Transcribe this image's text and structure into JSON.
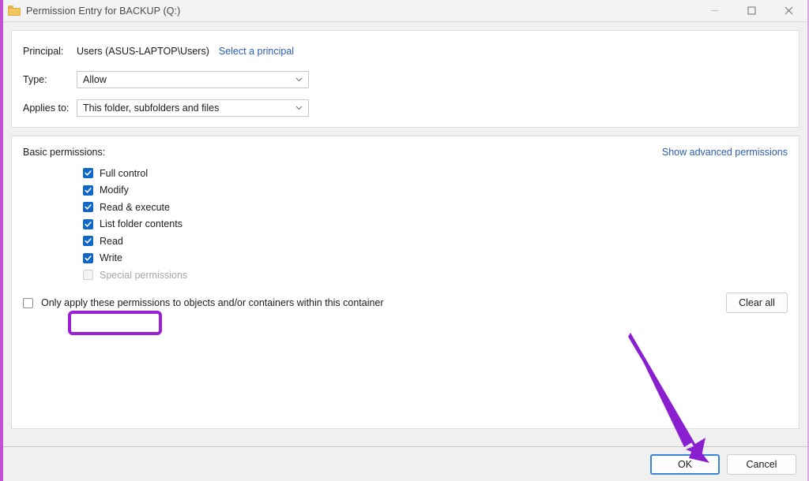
{
  "window": {
    "title": "Permission Entry for BACKUP (Q:)",
    "folder_icon": "folder-icon",
    "controls": {
      "minimize": "minimize-icon",
      "maximize": "maximize-icon",
      "close": "close-icon"
    },
    "accent_highlight_color": "#9b1fd4",
    "accent_arrow_color": "#8a1fd0",
    "focus_border_color": "#3a85d6",
    "checkbox_checked_color": "#0f67c8",
    "link_color": "#2a5db0"
  },
  "form": {
    "principal_label": "Principal:",
    "principal_value": "Users (ASUS-LAPTOP\\Users)",
    "select_principal_link": "Select a principal",
    "type_label": "Type:",
    "type_value": "Allow",
    "applies_to_label": "Applies to:",
    "applies_to_value": "This folder, subfolders and files"
  },
  "permissions": {
    "section_label": "Basic permissions:",
    "advanced_link": "Show advanced permissions",
    "items": [
      {
        "label": "Full control",
        "checked": true,
        "disabled": false,
        "highlighted": true
      },
      {
        "label": "Modify",
        "checked": true,
        "disabled": false,
        "highlighted": false
      },
      {
        "label": "Read & execute",
        "checked": true,
        "disabled": false,
        "highlighted": false
      },
      {
        "label": "List folder contents",
        "checked": true,
        "disabled": false,
        "highlighted": false
      },
      {
        "label": "Read",
        "checked": true,
        "disabled": false,
        "highlighted": false
      },
      {
        "label": "Write",
        "checked": true,
        "disabled": false,
        "highlighted": false
      },
      {
        "label": "Special permissions",
        "checked": false,
        "disabled": true,
        "highlighted": false
      }
    ],
    "only_apply_label": "Only apply these permissions to objects and/or containers within this container",
    "only_apply_checked": false,
    "clear_all_label": "Clear all"
  },
  "footer": {
    "ok_label": "OK",
    "cancel_label": "Cancel"
  }
}
